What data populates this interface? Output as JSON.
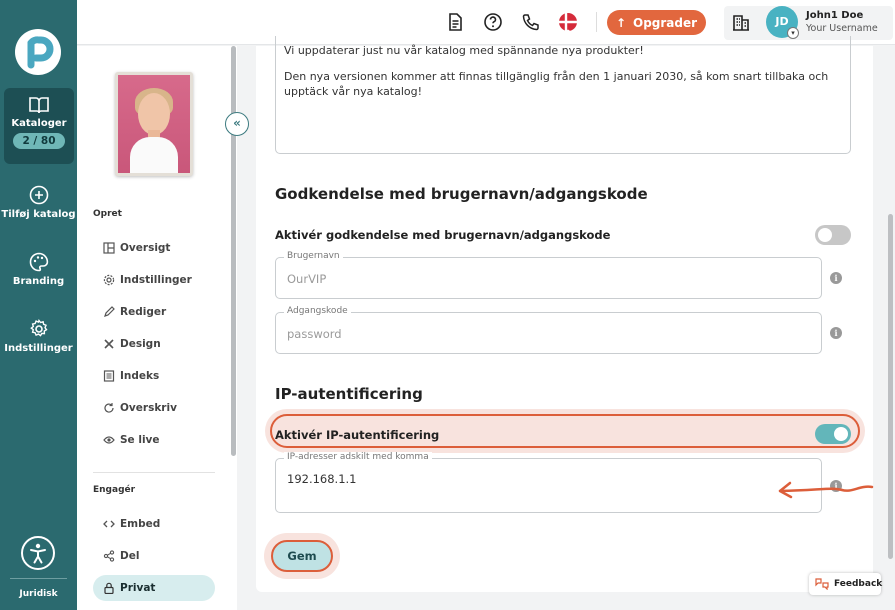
{
  "rail": {
    "items": [
      {
        "label": "Kataloger",
        "badge": "2 / 80",
        "icon": "book-open-icon"
      },
      {
        "label": "Tilføj katalog",
        "icon": "plus-circle-icon"
      },
      {
        "label": "Branding",
        "icon": "palette-icon"
      },
      {
        "label": "Indstillinger",
        "icon": "gear-icon"
      }
    ],
    "footer_label": "Juridisk"
  },
  "topbar": {
    "upgrade_label": "Opgrader",
    "user_initials": "JD",
    "user_name": "John1 Doe",
    "user_sub": "Your Username"
  },
  "sidebar": {
    "section_opret": "Opret",
    "opret_items": [
      {
        "label": "Oversigt",
        "icon": "layout-icon"
      },
      {
        "label": "Indstillinger",
        "icon": "gear-icon"
      },
      {
        "label": "Rediger",
        "icon": "pencil-icon"
      },
      {
        "label": "Design",
        "icon": "tools-icon"
      },
      {
        "label": "Indeks",
        "icon": "list-icon"
      },
      {
        "label": "Overskriv",
        "icon": "refresh-icon"
      },
      {
        "label": "Se live",
        "icon": "eye-icon"
      }
    ],
    "section_engager": "Engagér",
    "engager_items": [
      {
        "label": "Embed",
        "icon": "code-icon"
      },
      {
        "label": "Del",
        "icon": "share-icon"
      },
      {
        "label": "Privat",
        "icon": "lock-icon"
      }
    ]
  },
  "main": {
    "message_p1": "Vi uppdaterar just nu vår katalog med spännande nya produkter!",
    "message_p2": "Den nya versionen kommer att finnas tillgänglig från den 1 januari 2030, så kom snart tillbaka och upptäck vår nya katalog!",
    "auth_heading": "Godkendelse med brugernavn/adgangskode",
    "auth_toggle_label": "Aktivér godkendelse med brugernavn/adgangskode",
    "auth_toggle_on": false,
    "username_legend": "Brugernavn",
    "username_placeholder": "OurVIP",
    "password_legend": "Adgangskode",
    "password_placeholder": "password",
    "ip_heading": "IP-autentificering",
    "ip_toggle_label": "Aktivér IP-autentificering",
    "ip_toggle_on": true,
    "ip_legend": "IP-adresser adskilt med komma",
    "ip_value": "192.168.1.1",
    "save_label": "Gem"
  },
  "feedback_label": "Feedback",
  "colors": {
    "rail": "#2b6a6f",
    "accent": "#e2673e",
    "highlight": "#dc5e3a",
    "toggle_on": "#63b6ba",
    "avatar": "#49b2c2"
  }
}
